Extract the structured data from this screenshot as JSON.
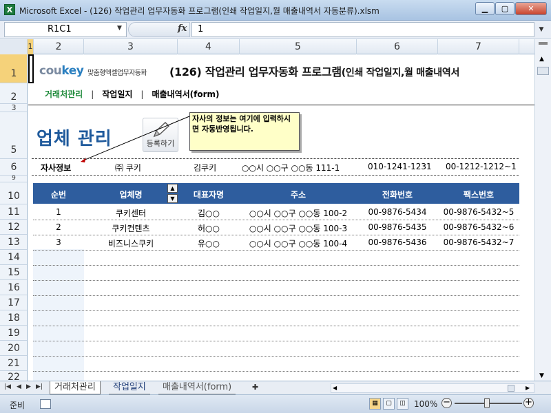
{
  "window": {
    "title": "Microsoft Excel - (126) 작업관리 업무자동화 프로그램(인쇄 작업일지,월 매출내역서 자동분류).xlsm",
    "app_icon": "X"
  },
  "formula": {
    "name_box": "R1C1",
    "fx": "fx",
    "value": "1"
  },
  "columns": [
    "1",
    "2",
    "3",
    "4",
    "5",
    "6",
    "7"
  ],
  "rows": [
    "1",
    "2",
    "3",
    "5",
    "6",
    "9",
    "10",
    "11",
    "12",
    "13",
    "14",
    "15",
    "16",
    "17",
    "18",
    "19",
    "20",
    "21",
    "22"
  ],
  "header": {
    "logo_main": "cou",
    "logo_accent": "key",
    "logo_sub": "맞춤형엑셀업무자동화",
    "title": "(126) 작업관리 업무자동화 프로그램",
    "title_sub": "(인쇄 작업일지,월 매출내역서"
  },
  "nav": {
    "items": [
      "거래처관리",
      "작업일지",
      "매출내역서(form)"
    ],
    "separator": "|"
  },
  "page": {
    "heading": "업체 관리",
    "register_label": "등록하기"
  },
  "tooltip": "자사의 정보는 여기에 입력하시면 자동반영됩니다.",
  "company_info": {
    "label": "자사정보",
    "name": "㈜ 쿠키",
    "ceo": "김쿠키",
    "address": "○○시 ○○구 ○○동 111-1",
    "phone": "010-1241-1231",
    "fax": "00-1212-1212~1"
  },
  "table": {
    "headers": [
      "순번",
      "업체명",
      "대표자명",
      "주소",
      "전화번호",
      "팩스번호"
    ],
    "rows": [
      [
        "1",
        "쿠키센터",
        "김○○",
        "○○시 ○○구 ○○동 100-2",
        "00-9876-5434",
        "00-9876-5432~5"
      ],
      [
        "2",
        "쿠키컨텐츠",
        "허○○",
        "○○시 ○○구 ○○동 100-3",
        "00-9876-5435",
        "00-9876-5432~6"
      ],
      [
        "3",
        "비즈니스쿠키",
        "유○○",
        "○○시 ○○구 ○○동 100-4",
        "00-9876-5436",
        "00-9876-5432~7"
      ]
    ]
  },
  "sheet_tabs": [
    "거래처관리",
    "작업일지",
    "매출내역서(form)"
  ],
  "status": {
    "ready": "준비",
    "zoom": "100%"
  },
  "colors": {
    "accent": "#2e5d9e",
    "heading": "#1f5a9c",
    "nav_active": "#1e8a3a"
  }
}
